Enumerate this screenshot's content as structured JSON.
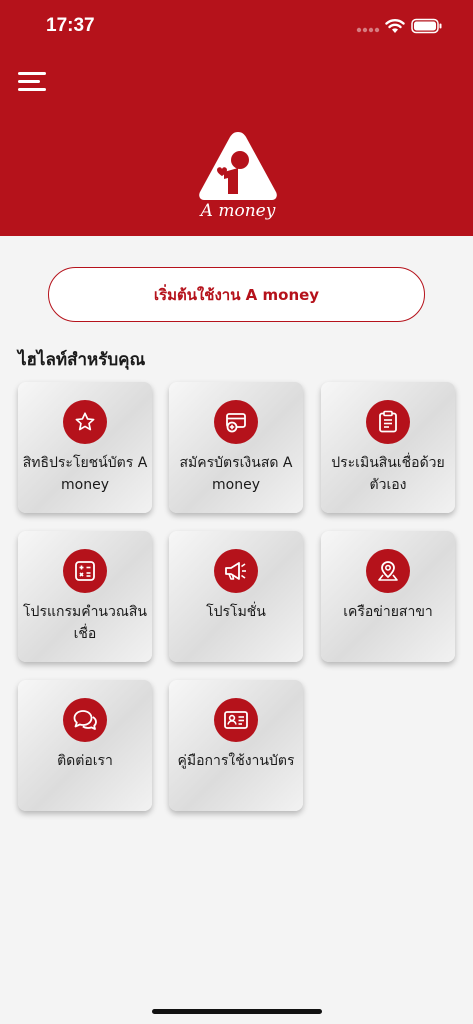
{
  "status_bar": {
    "time": "17:37"
  },
  "header": {
    "logo_text": "A money",
    "menu_icon": "hamburger-menu-icon"
  },
  "start_button": {
    "label": "เริ่มต้นใช้งาน A money"
  },
  "section": {
    "title": "ไฮไลท์สำหรับคุณ"
  },
  "tiles": [
    {
      "label": "สิทธิประโยชน์บัตร A money",
      "icon": "star-icon"
    },
    {
      "label": "สมัครบัตรเงินสด A money",
      "icon": "card-add-icon"
    },
    {
      "label": "ประเมินสินเชื่อด้วยตัวเอง",
      "icon": "clipboard-icon"
    },
    {
      "label": "โปรแกรมคำนวณสินเชื่อ",
      "icon": "calculator-icon"
    },
    {
      "label": "โปรโมชั่น",
      "icon": "megaphone-icon"
    },
    {
      "label": "เครือข่ายสาขา",
      "icon": "location-map-icon"
    },
    {
      "label": "ติดต่อเรา",
      "icon": "chat-bubbles-icon"
    },
    {
      "label": "คู่มือการใช้งานบัตร",
      "icon": "id-card-icon"
    }
  ],
  "colors": {
    "brand_red": "#b5121b",
    "background": "#f4f4f4"
  }
}
